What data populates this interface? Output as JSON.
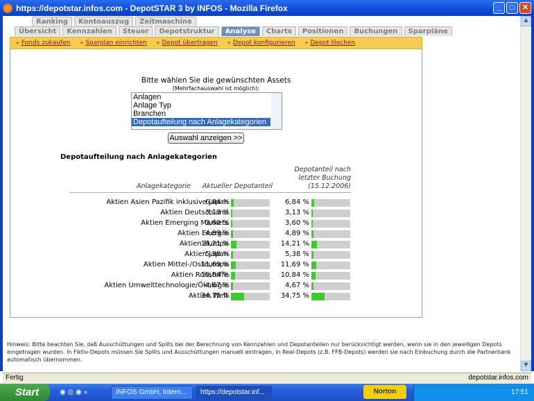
{
  "window": {
    "title": "https://depotstar.infos.com - DepotSTAR 3 by INFOS - Mozilla Firefox"
  },
  "tabs_row1": [
    "Ranking",
    "Kontoauszug",
    "Zeitmaschine"
  ],
  "tabs_row2": [
    "Übersicht",
    "Kennzahlen",
    "Steuer",
    "Depotstruktur",
    "Analyse",
    "Charts",
    "Positionen",
    "Buchungen",
    "Sparpläne"
  ],
  "active_tab": "Analyse",
  "actions": [
    "Fonds zukaufen",
    "Sparplan einrichten",
    "Depot übertragen",
    "Depot konfigurieren",
    "Depot löschen"
  ],
  "selection": {
    "prompt": "Bitte wählen Sie die gewünschten Assets",
    "hint": "(Mehrfachauswahl ist möglich):",
    "options": [
      "Anlagen",
      "Anlage Typ",
      "Branchen",
      "Depotaufteilung nach Anlagekategorien"
    ],
    "selected": "Depotaufteilung nach Anlagekategorien",
    "button": "Auswahl anzeigen >>"
  },
  "table": {
    "title": "Depotaufteilung nach Anlagekategorien",
    "headers": {
      "category": "Anlagekategorie",
      "current": "Aktueller Depotanteil",
      "last_l1": "Depotanteil nach",
      "last_l2": "letzter Buchung",
      "last_l3": "(15.12.2006)"
    },
    "rows": [
      {
        "label": "Aktien Asien Pazifik inklusive Japan",
        "current": "6,84 %",
        "last": "6,84 %",
        "pct": 6.84
      },
      {
        "label": "Aktien Deutschland",
        "current": "3,13 %",
        "last": "3,13 %",
        "pct": 3.13
      },
      {
        "label": "Aktien Emerging Markets",
        "current": "3,60 %",
        "last": "3,60 %",
        "pct": 3.6
      },
      {
        "label": "Aktien Energie",
        "current": "4,89 %",
        "last": "4,89 %",
        "pct": 4.89
      },
      {
        "label": "Aktien Europa",
        "current": "14,21 %",
        "last": "14,21 %",
        "pct": 14.21
      },
      {
        "label": "Aktien Japan",
        "current": "5,38 %",
        "last": "5,38 %",
        "pct": 5.38
      },
      {
        "label": "Aktien Mittel-/Osteuropa",
        "current": "11,69 %",
        "last": "11,69 %",
        "pct": 11.69
      },
      {
        "label": "Aktien Rohstoffe",
        "current": "10,84 %",
        "last": "10,84 %",
        "pct": 10.84
      },
      {
        "label": "Aktien Umwelttechnologie/Ökologie",
        "current": "4,67 %",
        "last": "4,67 %",
        "pct": 4.67
      },
      {
        "label": "Aktien Welt",
        "current": "34,75 %",
        "last": "34,75 %",
        "pct": 34.75
      }
    ]
  },
  "note": "Hinweis: Bitte beachten Sie, daß Ausschüttungen und Splits bei der Berechnung von Kennzahlen und Depotanteilen nur berücksichtigt werden, wenn sie in den jeweiligen Depots eingetragen wurden. In Fiktiv-Depots müssen Sie Splits und Ausschüttungen manuell eintragen, in Real-Depots (z.B. FFB-Depots) werden sie nach Einbuchung durch die Partnerbank automatisch übernommen.",
  "status": {
    "text": "Fertig",
    "host": "depotstar.infos.com"
  },
  "taskbar": {
    "start": "Start",
    "items": [
      "INFOS GmbH, Intern...",
      "https://depotstar.inf..."
    ],
    "norton": "Norton",
    "clock": "17:51"
  },
  "colors": {
    "bar_fill": "#3ccc2a",
    "bar_bg": "#cfcfcf",
    "action_bar": "#f5cc52",
    "active_tab": "#6f8fc0"
  }
}
